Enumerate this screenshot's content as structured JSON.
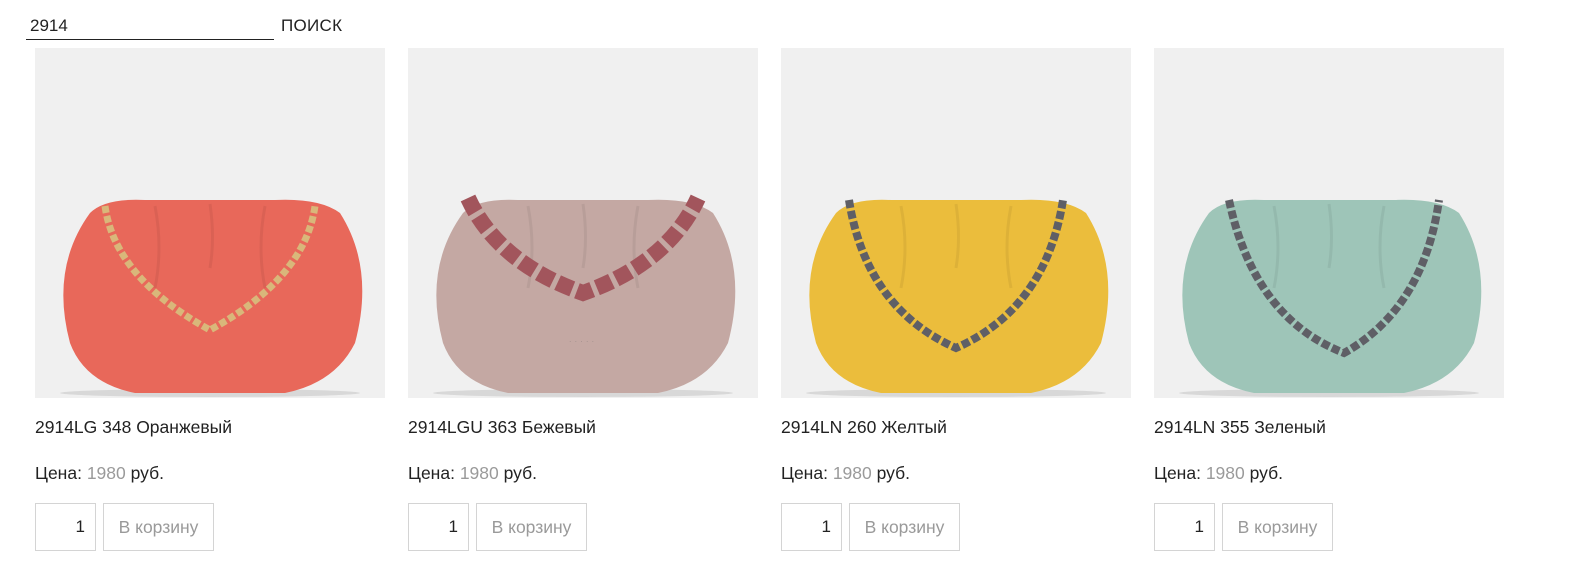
{
  "search": {
    "value": "2914",
    "button_label": "ПОИСК"
  },
  "products": [
    {
      "title": "2914LG 348 Оранжевый",
      "price_label": "Цена:",
      "price": "1980",
      "currency": "руб.",
      "quantity": "1",
      "cart_label": "В корзину",
      "bag_color": "#e8685a",
      "chain_color": "#d9b77a",
      "image": "orange leather clutch bag with gold chain handle"
    },
    {
      "title": "2914LGU 363 Бежевый",
      "price_label": "Цена:",
      "price": "1980",
      "currency": "руб.",
      "quantity": "1",
      "cart_label": "В корзину",
      "bag_color": "#c4a8a3",
      "chain_color": "#a2555c",
      "image": "beige leather clutch bag with chunky burgundy chain handle"
    },
    {
      "title": "2914LN 260 Желтый",
      "price_label": "Цена:",
      "price": "1980",
      "currency": "руб.",
      "quantity": "1",
      "cart_label": "В корзину",
      "bag_color": "#ebbd3c",
      "chain_color": "#5f5f66",
      "image": "yellow leather clutch bag with gunmetal chain handle"
    },
    {
      "title": "2914LN 355 Зеленый",
      "price_label": "Цена:",
      "price": "1980",
      "currency": "руб.",
      "quantity": "1",
      "cart_label": "В корзину",
      "bag_color": "#9ec5b8",
      "chain_color": "#5f5f66",
      "image": "mint green leather clutch bag with gunmetal chain handle"
    }
  ]
}
